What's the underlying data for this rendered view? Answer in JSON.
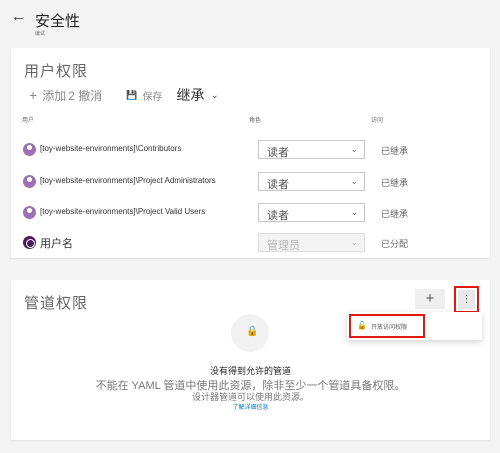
{
  "header": {
    "title": "安全性",
    "subtitle": "编试"
  },
  "user_permissions": {
    "title": "用户权限",
    "toolbar": {
      "add_label": "添加",
      "undo_label": "2 撤消",
      "save_label": "保存",
      "inherit_label": "继承"
    },
    "columns": {
      "user": "用户",
      "role": "角色",
      "access": "访问"
    },
    "rows": [
      {
        "name": "[toy-website-environments]\\Contributors",
        "role": "读者",
        "access": "已继承"
      },
      {
        "name": "[toy-website-environments]\\Project Administrators",
        "role": "读者",
        "access": "已继承"
      },
      {
        "name": "[toy-website-environments]\\Project Valid Users",
        "role": "读者",
        "access": "已继承"
      },
      {
        "name": "用户名",
        "role": "管理员",
        "access": "已分配"
      }
    ]
  },
  "pipeline_permissions": {
    "title": "管道权限",
    "add_icon": "plus-icon",
    "more_icon": "more-vertical-icon",
    "menu": {
      "open_access_label": "开放访问权限"
    },
    "empty": {
      "title": "没有得到允许的管道",
      "description": "不能在 YAML 管道中使用此资源，除非至少一个管道具备权限。",
      "description2": "设计器管道可以使用此资源。",
      "link": "了解详细信息"
    }
  },
  "colors": {
    "highlight": "#e1190e",
    "avatar_group": "#9b73b2",
    "avatar_user": "#4b1f5c",
    "link": "#0078d4"
  }
}
